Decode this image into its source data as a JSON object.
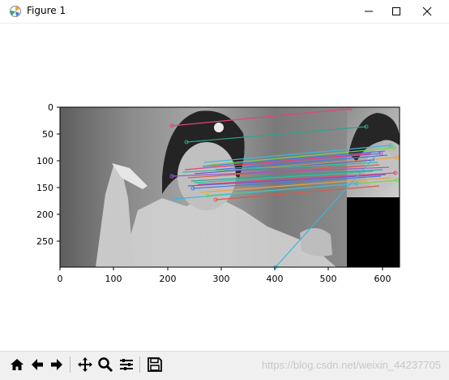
{
  "window": {
    "title": "Figure 1",
    "controls": [
      "minimize-icon",
      "maximize-icon",
      "close-icon"
    ]
  },
  "chart_data": {
    "type": "image",
    "xticks": [
      "0",
      "100",
      "200",
      "300",
      "400",
      "500",
      "600"
    ],
    "yticks": [
      "0",
      "50",
      "100",
      "150",
      "200",
      "250"
    ],
    "xlim": [
      0,
      632
    ],
    "ylim": [
      300,
      0
    ],
    "match_colors": [
      "#e0457b",
      "#2ca58d",
      "#4b7bd8",
      "#9b59d0",
      "#e8a34a",
      "#3cb8d8",
      "#7bd34a",
      "#d85a4b",
      "#6a5acd",
      "#30c0a0"
    ]
  },
  "toolbar": {
    "items": [
      "home-icon",
      "back-icon",
      "forward-icon",
      "pan-icon",
      "zoom-icon",
      "configure-subplots-icon",
      "save-icon"
    ],
    "watermark": "https://blog.csdn.net/weixin_44237705"
  }
}
